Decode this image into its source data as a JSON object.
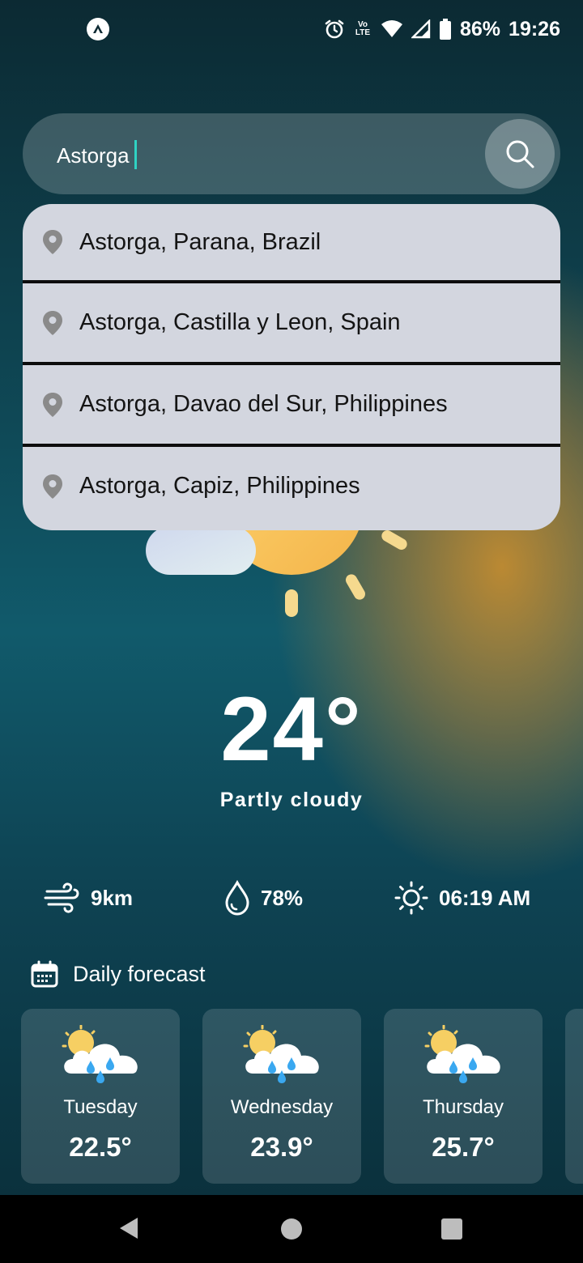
{
  "status_bar": {
    "battery": "86%",
    "time": "19:26",
    "volte_top": "Vo",
    "volte_bottom": "LTE"
  },
  "search": {
    "value": "Astorga",
    "icon": "search-icon"
  },
  "suggestions": [
    {
      "label": "Astorga, Parana, Brazil"
    },
    {
      "label": "Astorga, Castilla y Leon, Spain"
    },
    {
      "label": "Astorga, Davao del Sur, Philippines"
    },
    {
      "label": "Astorga, Capiz, Philippines"
    }
  ],
  "current": {
    "temperature": "24°",
    "condition": "Partly cloudy",
    "icon": "partly-cloudy-icon"
  },
  "stats": {
    "wind": "9km",
    "humidity": "78%",
    "sunrise": "06:19 AM"
  },
  "forecast": {
    "title": "Daily forecast",
    "days": [
      {
        "day": "Tuesday",
        "temp": "22.5°",
        "icon": "rain-cloud-icon"
      },
      {
        "day": "Wednesday",
        "temp": "23.9°",
        "icon": "rain-cloud-icon"
      },
      {
        "day": "Thursday",
        "temp": "25.7°",
        "icon": "rain-cloud-icon"
      }
    ]
  },
  "colors": {
    "caret": "#2fd3c3",
    "suggestion_bg": "#d3d6df",
    "sun": "#f7c65a"
  }
}
